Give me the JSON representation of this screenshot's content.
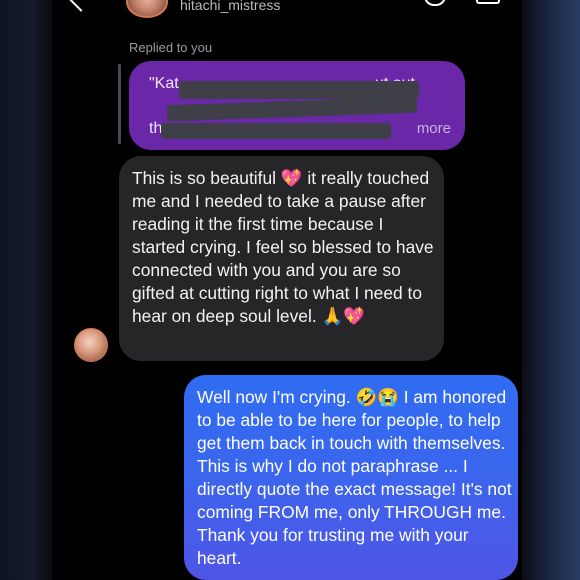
{
  "header": {
    "username": "hitachi_mistress"
  },
  "reply": {
    "label": "Replied to you",
    "quoted_line1_start": "\"Kat",
    "quoted_line1_end": "ut out",
    "quoted_line2_start": "th",
    "more_label": "more"
  },
  "incoming": {
    "text": "This is so beautiful 💖 it really touched me and I needed to take a pause after reading it the first time because I started crying. I feel so blessed to have connected with you and you are so gifted at cutting right to what I need to hear on deep soul level. 🙏💖"
  },
  "outgoing": {
    "text": "Well now I'm crying. 🤣😭 I am honored to be able to be here for people, to help get them back in touch with themselves. This is why I do not paraphrase ... I directly quote the exact message! It's not coming FROM me, only THROUGH me. Thank you for trusting me with your heart."
  },
  "colors": {
    "quoted_bubble": "#6a27a8",
    "incoming_bubble": "#262629",
    "outgoing_bubble_top": "#2f6df2",
    "outgoing_bubble_bottom": "#4f55e6"
  }
}
